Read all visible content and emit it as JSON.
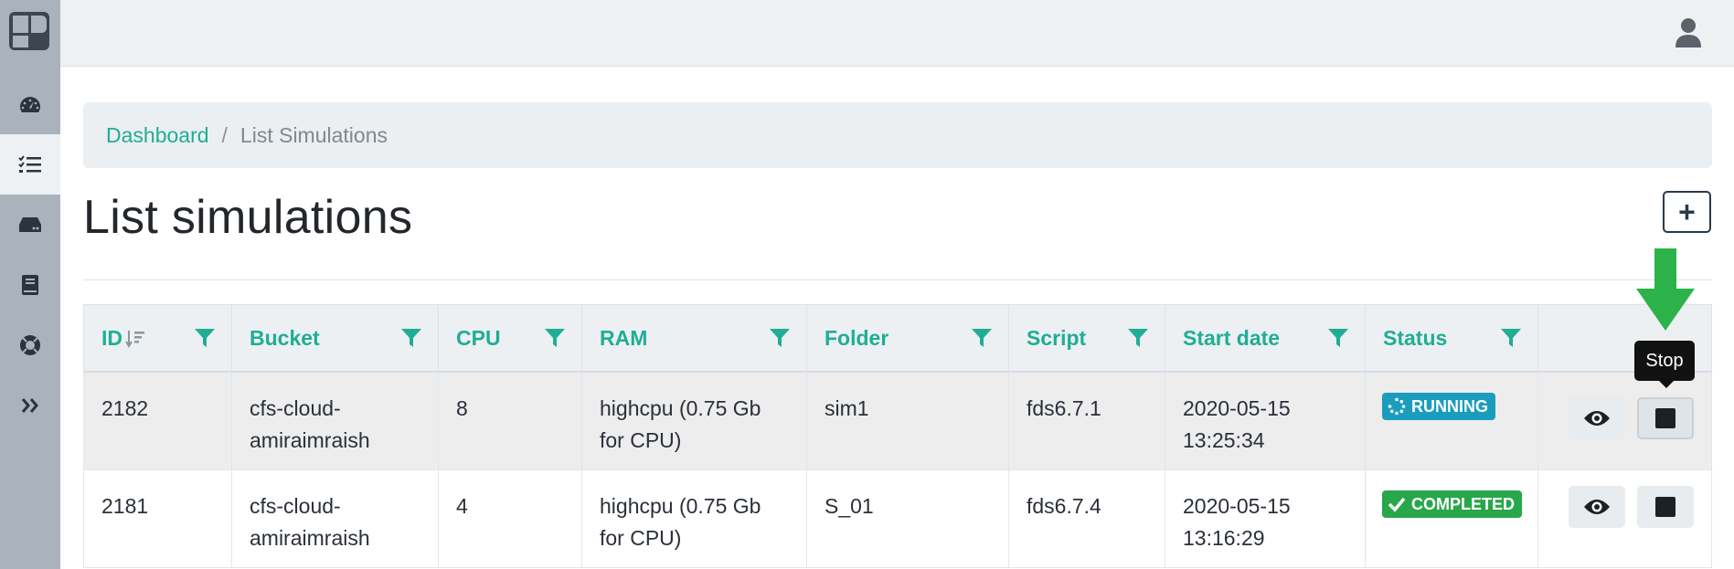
{
  "colors": {
    "accent": "#1fae94",
    "sidebar": "#aab3bc",
    "running": "#1a9dbd",
    "completed": "#27a74a",
    "annotation": "#2bb34a"
  },
  "sidebar": {
    "items": [
      {
        "icon": "speedometer-icon"
      },
      {
        "icon": "list-check-icon",
        "active": true
      },
      {
        "icon": "hard-drive-icon"
      },
      {
        "icon": "book-icon"
      },
      {
        "icon": "lifebuoy-icon"
      },
      {
        "icon": "double-chevron-right-icon"
      }
    ]
  },
  "topbar": {
    "user_icon": "user-icon"
  },
  "breadcrumb": {
    "home": "Dashboard",
    "separator": "/",
    "current": "List Simulations"
  },
  "page": {
    "title": "List simulations",
    "add_label": "+"
  },
  "table": {
    "columns": [
      "ID",
      "Bucket",
      "CPU",
      "RAM",
      "Folder",
      "Script",
      "Start date",
      "Status"
    ],
    "rows": [
      {
        "id": "2182",
        "bucket_1": "cfs-cloud-",
        "bucket_2": "amiraimraish",
        "cpu": "8",
        "ram_1": "highcpu (0.75 Gb",
        "ram_2": "for CPU)",
        "folder": "sim1",
        "script": "fds6.7.1",
        "date": "2020-05-15",
        "time": "13:25:34",
        "status": "RUNNING"
      },
      {
        "id": "2181",
        "bucket_1": "cfs-cloud-",
        "bucket_2": "amiraimraish",
        "cpu": "4",
        "ram_1": "highcpu (0.75 Gb",
        "ram_2": "for CPU)",
        "folder": "S_01",
        "script": "fds6.7.4",
        "date": "2020-05-15",
        "time": "13:16:29",
        "status": "COMPLETED"
      }
    ]
  },
  "tooltip": {
    "text": "Stop"
  }
}
